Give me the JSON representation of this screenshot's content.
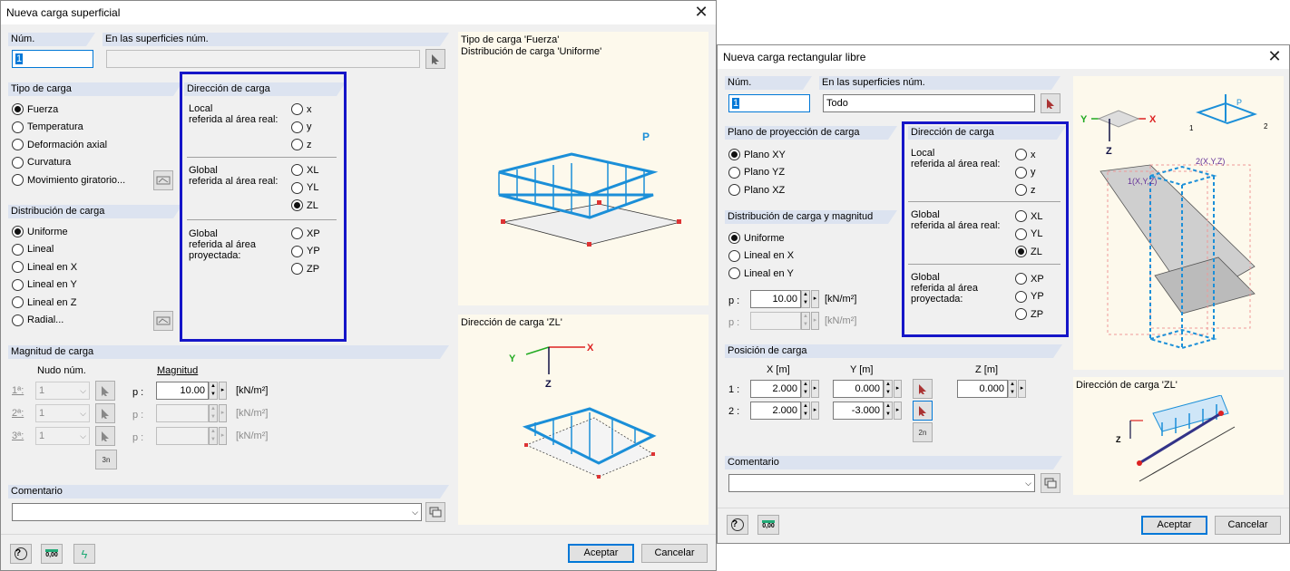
{
  "dialog1": {
    "title": "Nueva carga superficial",
    "num_label": "Núm.",
    "num_value": "1",
    "surfaces_label": "En las superficies núm.",
    "surfaces_value": "",
    "tipo_title": "Tipo de carga",
    "tipo_options": [
      "Fuerza",
      "Temperatura",
      "Deformación axial",
      "Curvatura",
      "Movimiento giratorio..."
    ],
    "dir_title": "Dirección de carga",
    "local_label": "Local\nreferida al área real:",
    "global_label": "Global\nreferida al área real:",
    "proj_label": "Global\nreferida al área\nproyectada:",
    "local_opts": [
      "x",
      "y",
      "z"
    ],
    "global_opts": [
      "XL",
      "YL",
      "ZL"
    ],
    "proj_opts": [
      "XP",
      "YP",
      "ZP"
    ],
    "dist_title": "Distribución de carga",
    "dist_options": [
      "Uniforme",
      "Lineal",
      "Lineal en X",
      "Lineal en Y",
      "Lineal en Z",
      "Radial..."
    ],
    "mag_title": "Magnitud de carga",
    "nodo_label": "Nudo núm.",
    "magnitud_label": "Magnitud",
    "rows": [
      {
        "n": "1ª:",
        "node": "1",
        "p": "p :",
        "val": "10.00",
        "unit": "[kN/m²]"
      },
      {
        "n": "2ª:",
        "node": "1",
        "p": "p :",
        "val": "",
        "unit": "[kN/m²]"
      },
      {
        "n": "3ª:",
        "node": "1",
        "p": "p :",
        "val": "",
        "unit": "[kN/m²]"
      }
    ],
    "comment_title": "Comentario",
    "comment_value": "",
    "info1": "Tipo de carga 'Fuerza'\nDistribución de carga 'Uniforme'",
    "info2": "Dirección de carga 'ZL'",
    "img_P": "P",
    "axis_Y": "Y",
    "axis_X": "X",
    "axis_Z": "Z",
    "icon_calc": "0,00",
    "icon_3n": "3n",
    "ok": "Aceptar",
    "cancel": "Cancelar"
  },
  "dialog2": {
    "title": "Nueva carga rectangular libre",
    "num_label": "Núm.",
    "num_value": "1",
    "surfaces_label": "En las superficies núm.",
    "surfaces_value": "Todo",
    "plano_title": "Plano de proyección de carga",
    "plano_options": [
      "Plano XY",
      "Plano YZ",
      "Plano XZ"
    ],
    "dir_title": "Dirección de carga",
    "local_label": "Local\nreferida al área real:",
    "global_label": "Global\nreferida al área real:",
    "proj_label": "Global\nreferida al área\nproyectada:",
    "local_opts": [
      "x",
      "y",
      "z"
    ],
    "global_opts": [
      "XL",
      "YL",
      "ZL"
    ],
    "proj_opts": [
      "XP",
      "YP",
      "ZP"
    ],
    "dist_title": "Distribución de carga y magnitud",
    "dist_options": [
      "Uniforme",
      "Lineal en  X",
      "Lineal en Y"
    ],
    "p1_label": "p :",
    "p1_value": "10.00",
    "p1_unit": "[kN/m²]",
    "p2_label": "p :",
    "p2_value": "",
    "p2_unit": "[kN/m²]",
    "pos_title": "Posición de carga",
    "col_x": "X  [m]",
    "col_y": "Y  [m]",
    "col_z": "Z  [m]",
    "pos_rows": [
      {
        "n": "1 :",
        "x": "2.000",
        "y": "0.000",
        "z": "0.000"
      },
      {
        "n": "2 :",
        "x": "2.000",
        "y": "-3.000"
      }
    ],
    "comment_title": "Comentario",
    "comment_value": "",
    "info2": "Dirección de carga 'ZL'",
    "img_labels": {
      "y": "Y",
      "x": "X",
      "z": "Z",
      "p": "P",
      "one": "1",
      "two": "2",
      "pt1": "1(X,Y,Z)",
      "pt2": "2(X,Y,Z)"
    },
    "icon_calc": "0,00",
    "icon_2n": "2n",
    "ok": "Aceptar",
    "cancel": "Cancelar"
  }
}
